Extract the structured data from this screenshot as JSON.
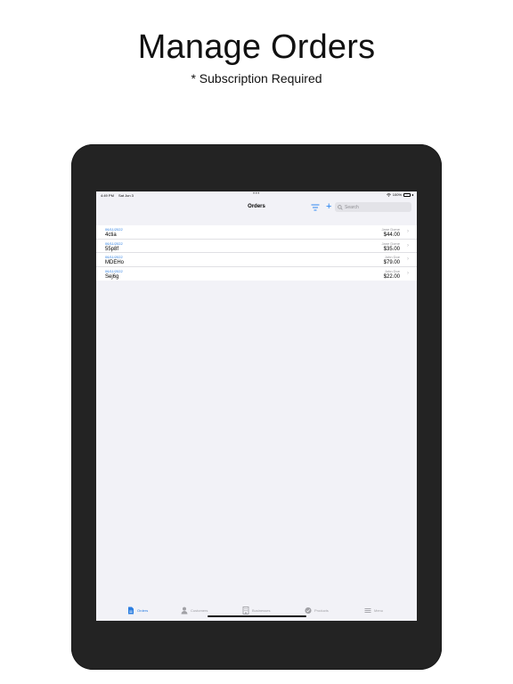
{
  "promo": {
    "title": "Manage Orders",
    "subtitle": "* Subscription Required"
  },
  "status_bar": {
    "time": "4:49 PM",
    "date": "Sat Jun 3",
    "dots": "•••",
    "battery": "100%"
  },
  "nav": {
    "title": "Orders",
    "add_label": "+",
    "search_placeholder": "Search"
  },
  "orders": [
    {
      "date": "06/11/2022",
      "id": "4ctia",
      "customer": "Jane Dome",
      "amount": "$44.00"
    },
    {
      "date": "06/11/2022",
      "id": "55p8f",
      "customer": "Jane Dome",
      "amount": "$35.00"
    },
    {
      "date": "06/11/2022",
      "id": "MDEHo",
      "customer": "John Doe",
      "amount": "$79.00"
    },
    {
      "date": "06/11/2022",
      "id": "Sej6g",
      "customer": "John Doe",
      "amount": "$22.00"
    }
  ],
  "tabs": [
    {
      "label": "Orders",
      "icon": "document-icon",
      "active": true
    },
    {
      "label": "Customers",
      "icon": "person-icon",
      "active": false
    },
    {
      "label": "Businesses",
      "icon": "building-icon",
      "active": false
    },
    {
      "label": "Products",
      "icon": "tag-icon",
      "active": false
    },
    {
      "label": "Menu",
      "icon": "menu-icon",
      "active": false
    }
  ],
  "colors": {
    "accent": "#2a7de1",
    "device_frame": "#232323",
    "screen_bg": "#f2f2f7"
  }
}
